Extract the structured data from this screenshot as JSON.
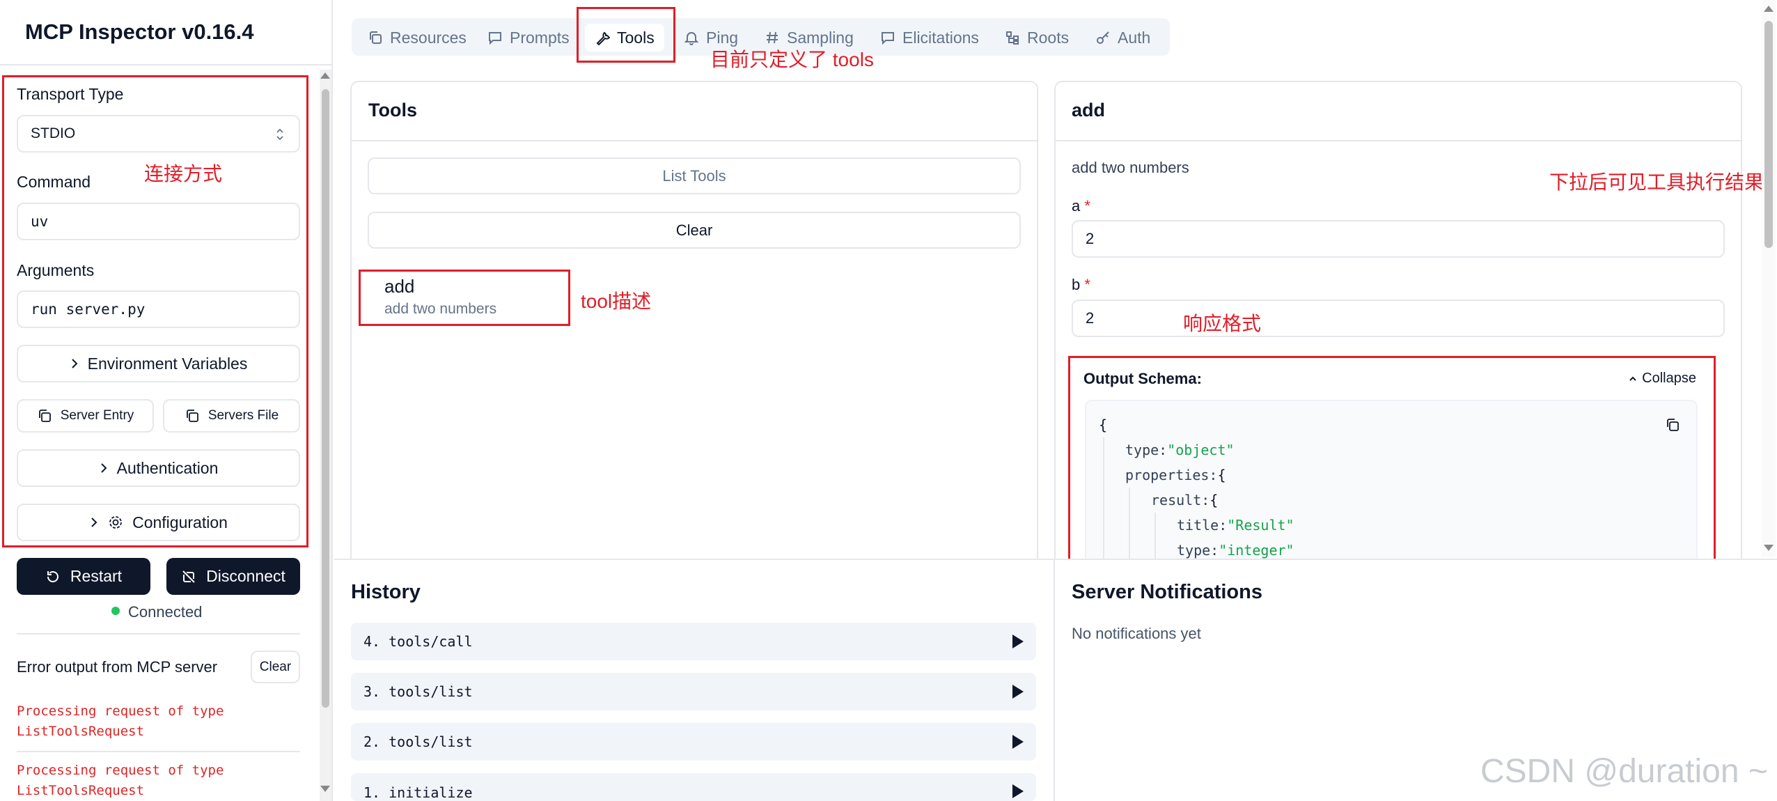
{
  "sidebar": {
    "title": "MCP Inspector v0.16.4",
    "transport_label": "Transport Type",
    "transport_value": "STDIO",
    "command_label": "Command",
    "command_value": "uv",
    "arguments_label": "Arguments",
    "arguments_value": "run server.py",
    "env_vars_label": "Environment Variables",
    "server_entry_label": "Server Entry",
    "servers_file_label": "Servers File",
    "auth_label": "Authentication",
    "config_label": "Configuration",
    "restart_label": "Restart",
    "disconnect_label": "Disconnect",
    "status_label": "Connected",
    "status_color": "#22c55e",
    "error_title": "Error output from MCP server",
    "error_clear_label": "Clear",
    "errors": [
      {
        "line1": "Processing request of type",
        "line2": "ListToolsRequest"
      },
      {
        "line1": "Processing request of type",
        "line2": "ListToolsRequest"
      }
    ]
  },
  "tabs": [
    {
      "label": "Resources",
      "icon": "resources-icon"
    },
    {
      "label": "Prompts",
      "icon": "prompts-icon"
    },
    {
      "label": "Tools",
      "icon": "tools-icon",
      "active": true
    },
    {
      "label": "Ping",
      "icon": "bell-icon"
    },
    {
      "label": "Sampling",
      "icon": "hash-icon"
    },
    {
      "label": "Elicitations",
      "icon": "message-icon"
    },
    {
      "label": "Roots",
      "icon": "tree-icon"
    },
    {
      "label": "Auth",
      "icon": "key-icon"
    }
  ],
  "tools_panel": {
    "title": "Tools",
    "list_tools_label": "List Tools",
    "clear_label": "Clear",
    "tool_name": "add",
    "tool_desc": "add two numbers"
  },
  "detail_panel": {
    "title": "add",
    "description": "add two numbers",
    "param_a_label": "a",
    "param_a_value": "2",
    "param_b_label": "b",
    "param_b_value": "2",
    "required_mark": "*",
    "output_schema_label": "Output Schema:",
    "collapse_label": "Collapse",
    "schema_lines": {
      "open": "{",
      "type_key": "type:",
      "type_val": "\"object\"",
      "props_key": "properties:",
      "props_open": "{",
      "result_key": "result:",
      "result_open": "{",
      "title_key": "title:",
      "title_val": "\"Result\"",
      "rtype_key": "type:",
      "rtype_val": "\"integer\""
    }
  },
  "history": {
    "title": "History",
    "items": [
      "4. tools/call",
      "3. tools/list",
      "2. tools/list",
      "1. initialize"
    ]
  },
  "notifications": {
    "title": "Server Notifications",
    "empty": "No notifications yet"
  },
  "annotations": {
    "tools_only": "目前只定义了 tools",
    "connection": "连接方式",
    "tool_desc": "tool描述",
    "response_format": "响应格式",
    "scroll_result": "下拉后可见工具执行结果"
  },
  "watermark": "CSDN @duration ~",
  "colors": {
    "annotation_red": "#e11d28",
    "dark_button": "#0f172a",
    "error_red": "#dc2626",
    "json_string": "#16a34a"
  }
}
